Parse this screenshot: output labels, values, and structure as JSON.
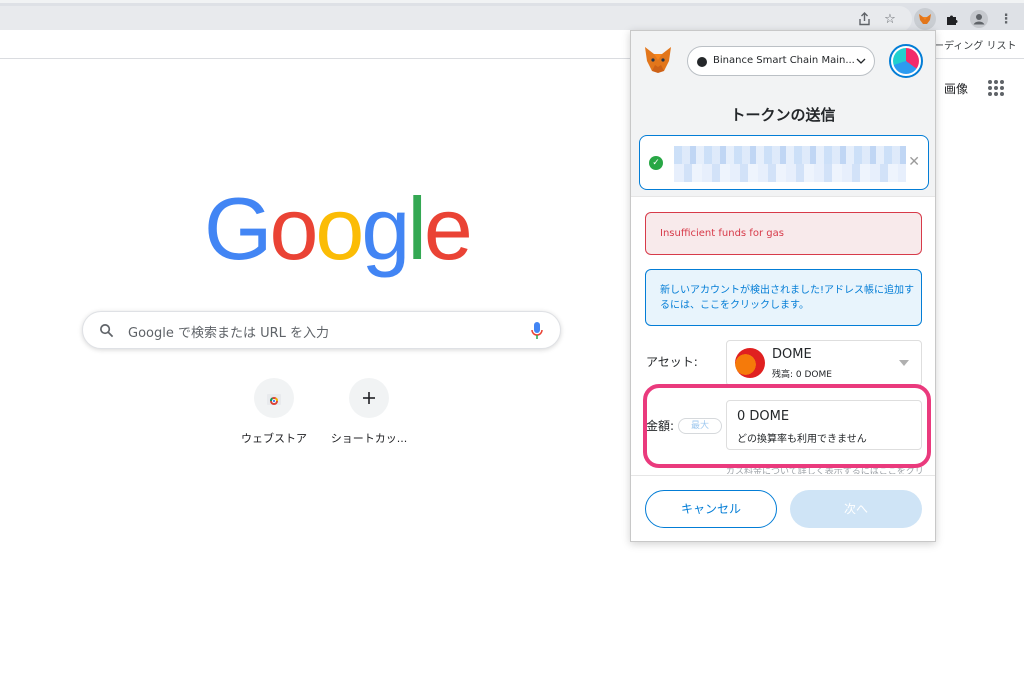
{
  "browser": {
    "reading_list_label": "ーディング リスト",
    "toolbar_icons": [
      "share-icon",
      "star-icon",
      "metamask-extension-icon",
      "puzzle-icon",
      "profile-icon",
      "kebab-menu-icon"
    ]
  },
  "ntp": {
    "images_link": "画像",
    "logo_letters": [
      {
        "char": "G",
        "color": "#4285f4"
      },
      {
        "char": "o",
        "color": "#ea4335"
      },
      {
        "char": "o",
        "color": "#fbbc05"
      },
      {
        "char": "g",
        "color": "#4285f4"
      },
      {
        "char": "l",
        "color": "#34a853"
      },
      {
        "char": "e",
        "color": "#ea4335"
      }
    ],
    "search_placeholder": "Google で検索または URL を入力",
    "shortcuts": [
      {
        "label": "ウェブストア",
        "icon": "chrome-web-store-icon"
      },
      {
        "label": "ショートカッ...",
        "icon": "plus-icon"
      }
    ]
  },
  "metamask": {
    "network_name": "Binance Smart Chain Main...",
    "title": "トークンの送信",
    "error_alert": "Insufficient funds for gas",
    "info_alert": "新しいアカウントが検出されました!アドレス帳に追加するには、ここをクリックします。",
    "asset_label": "アセット:",
    "asset": {
      "name": "DOME",
      "balance": "残高: 0 DOME"
    },
    "amount_label": "金額:",
    "max_label": "最大",
    "amount": {
      "value": "0",
      "unit": "DOME",
      "note": "どの換算率も利用できません"
    },
    "hidden_hint": "ガス料金について詳しく表示するにはここをクリック",
    "cancel_label": "キャンセル",
    "next_label": "次へ",
    "colors": {
      "accent": "#037dd6",
      "error": "#d73a49",
      "highlight": "#ea3a7d"
    }
  }
}
